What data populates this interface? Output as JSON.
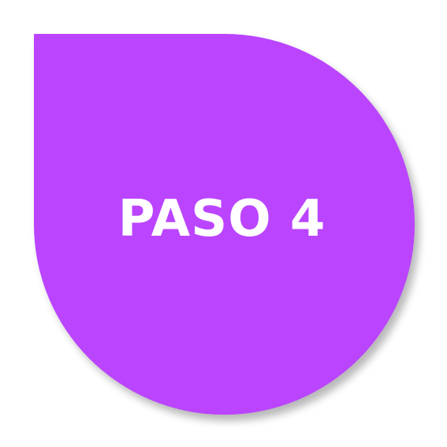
{
  "badge": {
    "label": "PASO 4",
    "fill_color": "#bb44ff",
    "text_color": "#ffffff",
    "shape": "teardrop"
  }
}
